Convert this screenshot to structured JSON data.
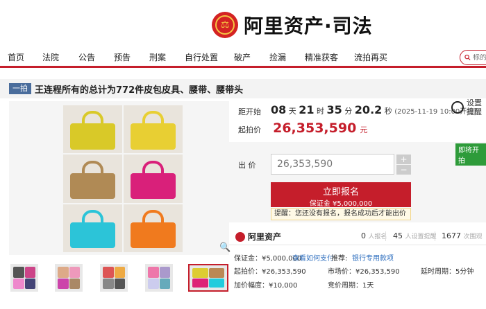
{
  "header": {
    "logo_text": "阿里资产·司法",
    "emblem_glyph": "⚖"
  },
  "nav": {
    "items": [
      "首页",
      "法院",
      "公告",
      "预告",
      "刑案",
      "自行处置",
      "破产",
      "捡漏",
      "精准获客",
      "流拍再买"
    ],
    "search_placeholder": "标的"
  },
  "item": {
    "tag": "一拍",
    "title": "王连程所有的总计为772件皮包皮具、腰带、腰带头"
  },
  "timer": {
    "label": "距开始",
    "days": "08",
    "days_unit": "天",
    "hours": "21",
    "hours_unit": "时",
    "minutes": "35",
    "minutes_unit": "分",
    "seconds": "20.2",
    "seconds_unit": "秒",
    "start_time": "(2025-11-19 10:00开拍)"
  },
  "reminder": {
    "line1": "设置",
    "line2": "提醒"
  },
  "price": {
    "label": "起拍价",
    "value": "26,353,590",
    "unit": "元"
  },
  "bid": {
    "badge": "即将开拍",
    "label": "出  价",
    "value": "26,353,590",
    "plus": "+",
    "minus": "−",
    "signup_label": "立即报名",
    "deposit_label": "保证金 ¥5,000,000",
    "tip": "提醒：您还没有报名，报名成功后才能出价"
  },
  "stats": {
    "brand": "阿里资产",
    "signups": "0",
    "signups_label": "人报名",
    "reminders": "45",
    "reminders_label": "人设置提醒",
    "views": "1677",
    "views_label": "次围观"
  },
  "details": {
    "deposit": "保证金：¥5,000,000",
    "how_to_pay": "查看如何支付",
    "recommend_label": "推荐:",
    "recommend_link": "银行专用款项",
    "start_price": "起拍价：¥26,353,590",
    "market_price": "市场价：¥26,353,590",
    "delay": "延时周期：5分钟",
    "increment": "加价幅度：¥10,000",
    "bid_period": "竞价周期：1天"
  },
  "colors": {
    "accent": "#c51e2b",
    "tag_bg": "#4a6d9c",
    "badge_green": "#2e9b3a"
  },
  "gallery": {
    "bag_colors": [
      "#d9c928",
      "#e8cf33",
      "#b08a55",
      "#d9207a",
      "#2cc4d8",
      "#f07a1e"
    ]
  }
}
